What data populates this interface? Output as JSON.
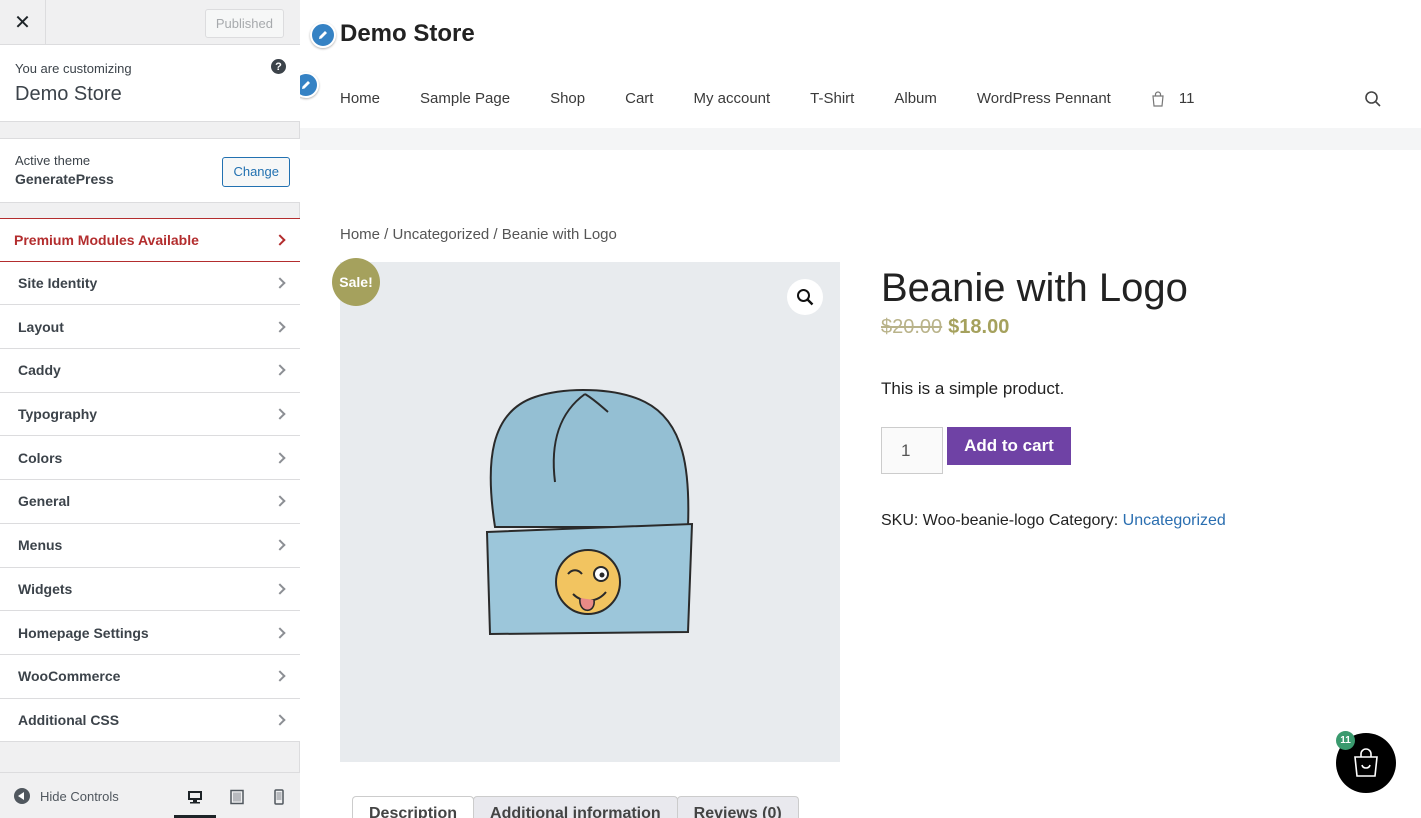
{
  "customizer": {
    "close_label": "✕",
    "publish_label": "Published",
    "info": {
      "customizing_label": "You are customizing",
      "site_name": "Demo Store"
    },
    "theme": {
      "label": "Active theme",
      "name": "GeneratePress",
      "change_label": "Change"
    },
    "menu": [
      "Premium Modules Available",
      "Site Identity",
      "Layout",
      "Caddy",
      "Typography",
      "Colors",
      "General",
      "Menus",
      "Widgets",
      "Homepage Settings",
      "WooCommerce",
      "Additional CSS"
    ],
    "footer": {
      "hide_controls": "Hide Controls"
    }
  },
  "site": {
    "title": "Demo Store",
    "nav": [
      "Home",
      "Sample Page",
      "Shop",
      "Cart",
      "My account",
      "T-Shirt",
      "Album",
      "WordPress Pennant"
    ],
    "cart_count": "11"
  },
  "product": {
    "breadcrumb": {
      "home": "Home",
      "category": "Uncategorized",
      "current": "Beanie with Logo",
      "sep": " / "
    },
    "sale_badge": "Sale!",
    "title": "Beanie with Logo",
    "old_price": "$20.00",
    "price": "$18.00",
    "description": "This is a simple product.",
    "quantity": "1",
    "add_to_cart": "Add to cart",
    "sku_label": "SKU:",
    "sku": "Woo-beanie-logo",
    "category_label": "Category:",
    "category": "Uncategorized",
    "tabs": [
      "Description",
      "Additional information",
      "Reviews (0)"
    ]
  },
  "caddy": {
    "count": "11"
  },
  "colors": {
    "accent": "#6f42a5",
    "sale": "#a5a15d",
    "link": "#2a6eb0",
    "premium": "#b32d2e"
  }
}
